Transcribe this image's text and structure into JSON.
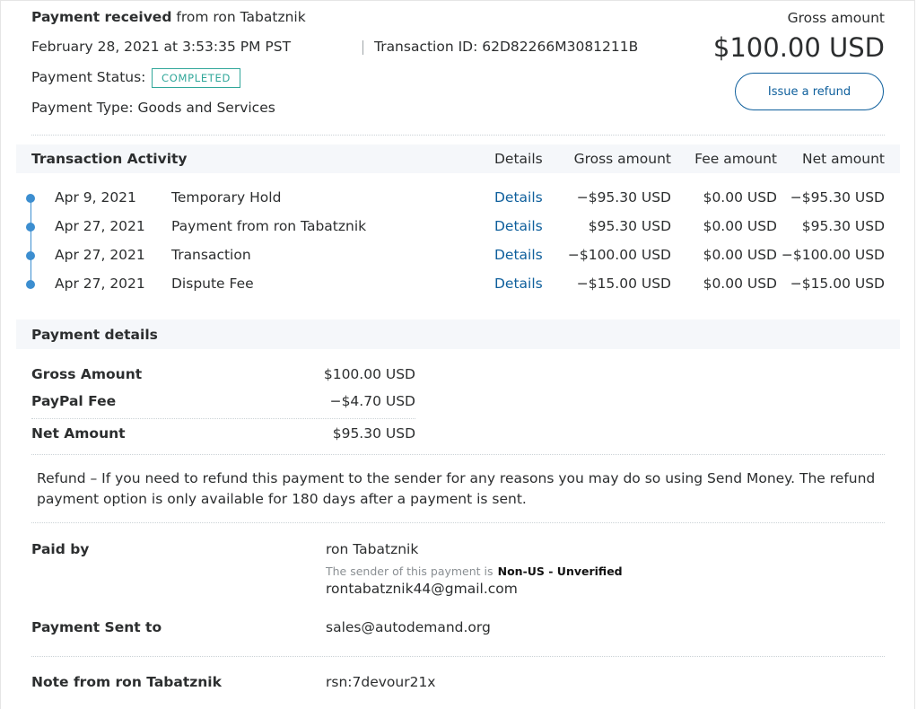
{
  "header": {
    "payment_received_label": "Payment received",
    "from_text": "from ron Tabatznik",
    "date": "February 28, 2021 at 3:53:35 PM PST",
    "transaction_id": "Transaction ID: 62D82266M3081211B",
    "status_label": "Payment Status:",
    "status_value": "COMPLETED",
    "type_label": "Payment Type: Goods and Services",
    "gross_label": "Gross amount",
    "gross_amount": "$100.00 USD",
    "refund_button": "Issue a refund"
  },
  "colors": {
    "accent_link": "#0e5f9c",
    "status_green": "#31a79a",
    "timeline_blue": "#3c8ed0",
    "band_bg": "#f5f7fa"
  },
  "activity": {
    "title": "Transaction Activity",
    "columns": [
      "Details",
      "Gross amount",
      "Fee amount",
      "Net amount"
    ],
    "rows": [
      {
        "date": "Apr 9, 2021",
        "description": "Temporary Hold",
        "details": "Details",
        "gross": "−$95.30 USD",
        "fee": "$0.00 USD",
        "net": "−$95.30 USD"
      },
      {
        "date": "Apr 27, 2021",
        "description": "Payment from ron Tabatznik",
        "details": "Details",
        "gross": "$95.30 USD",
        "fee": "$0.00 USD",
        "net": "$95.30 USD"
      },
      {
        "date": "Apr 27, 2021",
        "description": "Transaction",
        "details": "Details",
        "gross": "−$100.00 USD",
        "fee": "$0.00 USD",
        "net": "−$100.00 USD"
      },
      {
        "date": "Apr 27, 2021",
        "description": "Dispute Fee",
        "details": "Details",
        "gross": "−$15.00 USD",
        "fee": "$0.00 USD",
        "net": "−$15.00 USD"
      }
    ]
  },
  "payment_details": {
    "title": "Payment details",
    "gross_label": "Gross Amount",
    "gross_value": "$100.00 USD",
    "fee_label": "PayPal Fee",
    "fee_value": "−$4.70 USD",
    "net_label": "Net Amount",
    "net_value": "$95.30 USD",
    "refund_note_line1": "Refund – If you need to refund this payment to the sender for any reasons you may do so using Send Money. The refund",
    "refund_note_line2": "payment option is only available for 180 days after a payment is sent.",
    "paid_by_label": "Paid by",
    "paid_by_name": "ron Tabatznik",
    "sender_status_prefix": "The sender of this payment is",
    "sender_status_value": "Non-US - Unverified",
    "paid_by_email": "rontabatznik44@gmail.com",
    "sent_to_label": "Payment Sent to",
    "sent_to_value": "sales@autodemand.org",
    "note_label": "Note from ron Tabatznik",
    "note_value": "rsn:7devour21x"
  }
}
